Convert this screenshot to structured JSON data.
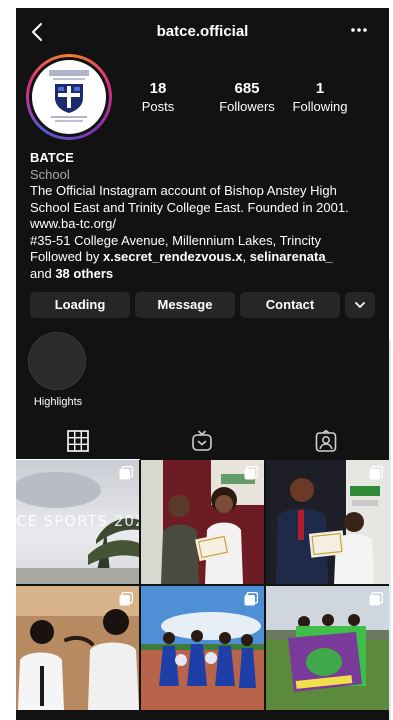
{
  "header": {
    "username": "batce.official"
  },
  "stats": [
    {
      "value": "18",
      "label": "Posts"
    },
    {
      "value": "685",
      "label": "Followers"
    },
    {
      "value": "1",
      "label": "Following"
    }
  ],
  "bio": {
    "name": "BATCE",
    "category": "School",
    "description": "The Official Instagram account of Bishop Anstey High School East and Trinity College East. Founded in 2001.",
    "website": "www.ba-tc.org/",
    "address": "#35-51 College Avenue, Millennium Lakes, Trincity",
    "followed_by_prefix": "Followed by ",
    "follower_1": "x.secret_rendezvous.x",
    "sep": ", ",
    "follower_2": "selinarenata_",
    "and_text": "and ",
    "others": "38 others"
  },
  "buttons": {
    "follow": "Loading",
    "message": "Message",
    "contact": "Contact"
  },
  "highlights": {
    "label": "Highlights"
  },
  "posts": [
    {
      "overlay_text": "CE SPORTS 202"
    },
    {
      "overlay_text": ""
    },
    {
      "overlay_text": ""
    },
    {
      "overlay_text": ""
    },
    {
      "overlay_text": ""
    },
    {
      "overlay_text": ""
    }
  ],
  "icons": {
    "back": "chevron-left-icon",
    "more": "more-horizontal-icon",
    "dropdown": "chevron-down-icon",
    "grid_tab": "grid-icon",
    "igtv_tab": "igtv-icon",
    "tagged_tab": "tagged-icon",
    "multi": "carousel-icon"
  },
  "colors": {
    "background": "#121212",
    "button": "#262626",
    "secondary_text": "#a8a8a8"
  }
}
